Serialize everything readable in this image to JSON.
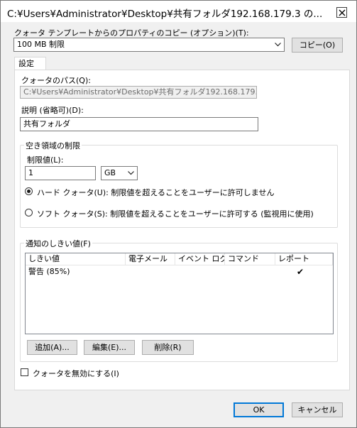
{
  "window": {
    "title": "C:¥Users¥Administrator¥Desktop¥共有フォルダ192.168.179.3 の..."
  },
  "template": {
    "label": "クォータ テンプレートからのプロパティのコピー (オプション)(T):",
    "selected": "100 MB 制限",
    "copy_button": "コピー(O)"
  },
  "tab": {
    "label": "設定"
  },
  "quota_path": {
    "label": "クォータのパス(Q):",
    "value": "C:¥Users¥Administrator¥Desktop¥共有フォルダ192.168.179.3"
  },
  "description": {
    "label": "説明 (省略可)(D):",
    "value": "共有フォルダ"
  },
  "space_limit": {
    "group_label": "空き領域の制限",
    "limit_label": "制限値(L):",
    "limit_value": "1",
    "unit": "GB",
    "hard_quota_label": "ハード クォータ(U): 制限値を超えることをユーザーに許可しません",
    "soft_quota_label": "ソフト クォータ(S): 制限値を超えることをユーザーに許可する (監視用に使用)"
  },
  "thresholds": {
    "group_label": "通知のしきい値(F)",
    "columns": [
      "しきい値",
      "電子メール",
      "イベント ログ",
      "コマンド",
      "レポート"
    ],
    "rows": [
      {
        "threshold": "警告 (85%)",
        "email": "",
        "event_log": "",
        "command": "",
        "report": "✔"
      }
    ],
    "add_button": "追加(A)...",
    "edit_button": "編集(E)...",
    "delete_button": "削除(R)"
  },
  "disable_quota": {
    "label": "クォータを無効にする(I)"
  },
  "footer": {
    "ok_button": "OK",
    "cancel_button": "キャンセル"
  }
}
